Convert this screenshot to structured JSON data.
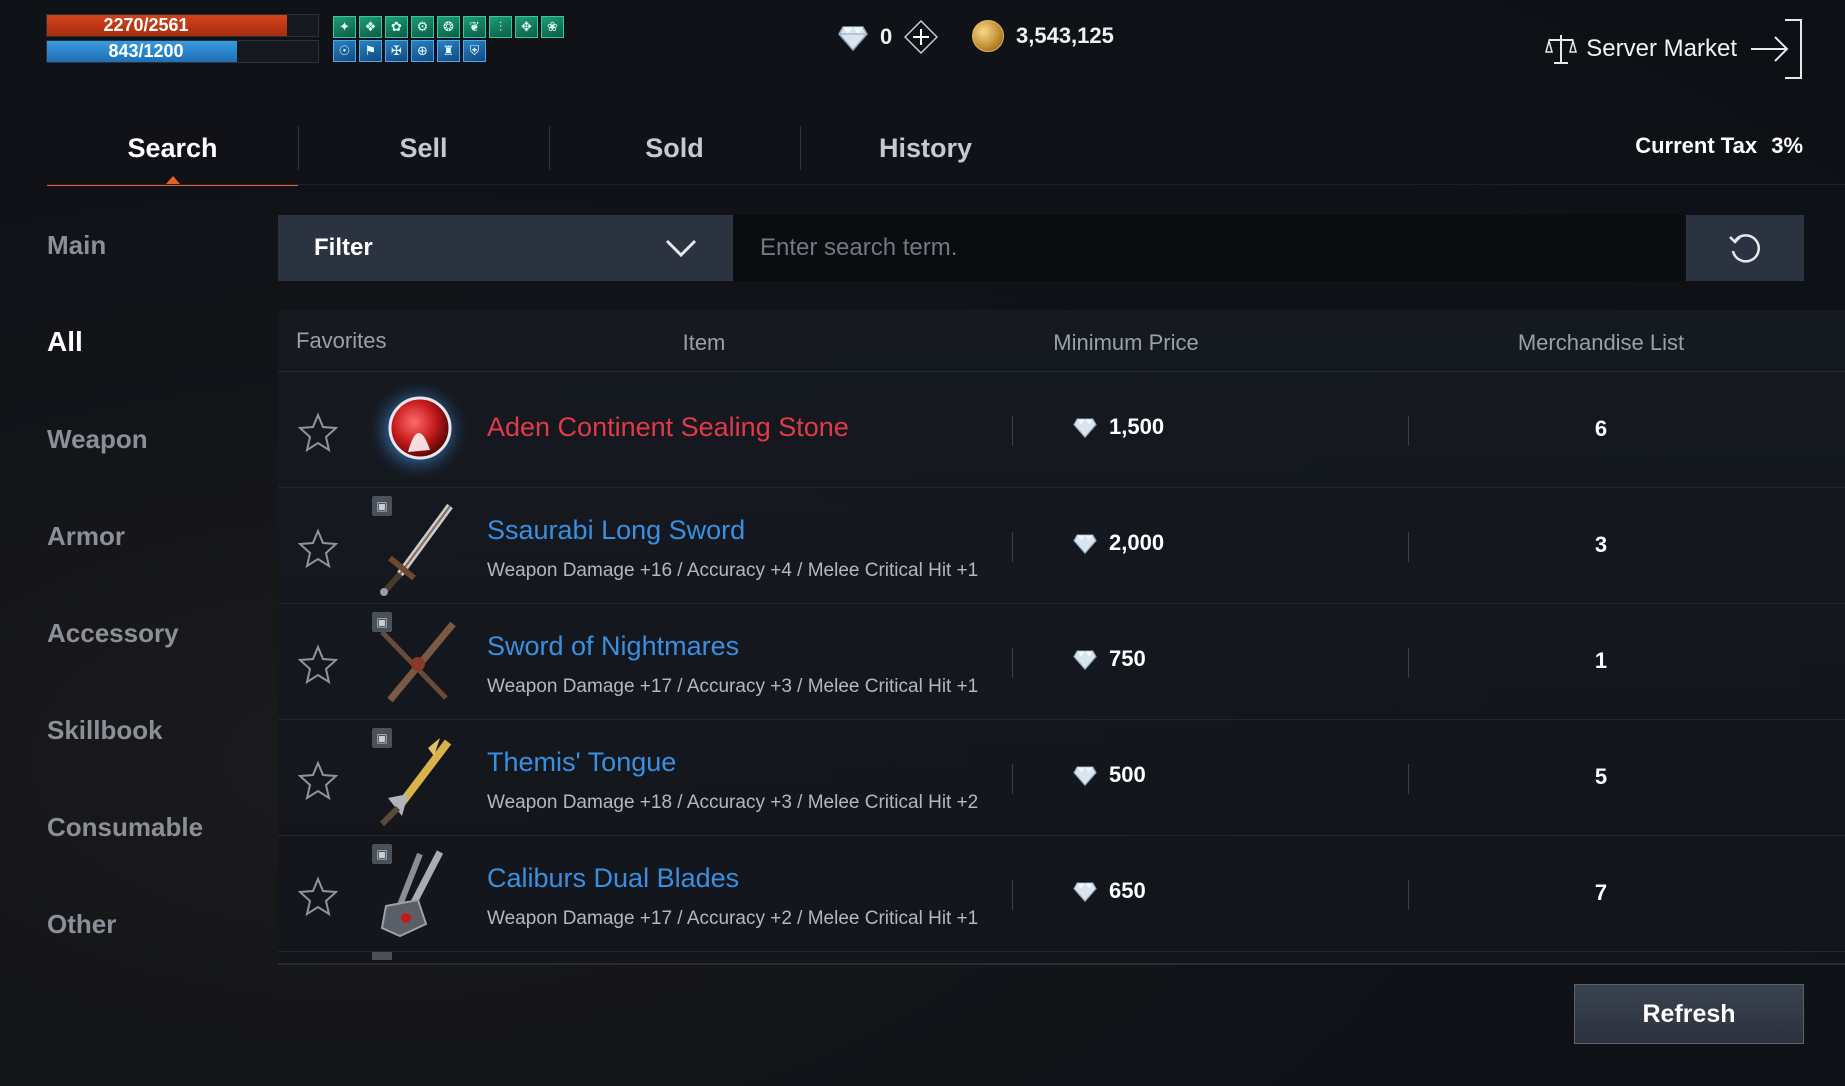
{
  "hud": {
    "hp_text": "2270/2561",
    "hp_ratio": 0.886,
    "mp_text": "843/1200",
    "mp_ratio": 0.7025,
    "buffs_row1": [
      "✦",
      "❖",
      "✿",
      "⚙",
      "❂",
      "❦",
      "⫶",
      "✥",
      "❀"
    ],
    "buffs_row2": [
      "☉",
      "⚑",
      "✠",
      "⊕",
      "♜",
      "⛨"
    ]
  },
  "currency": {
    "diamond": "0",
    "gold": "3,543,125"
  },
  "header": {
    "server_market": "Server Market",
    "current_tax_label": "Current Tax",
    "current_tax_value": "3%"
  },
  "tabs": [
    {
      "label": "Search",
      "active": true
    },
    {
      "label": "Sell",
      "active": false
    },
    {
      "label": "Sold",
      "active": false
    },
    {
      "label": "History",
      "active": false
    }
  ],
  "sidebar": {
    "items": [
      {
        "label": "Main"
      },
      {
        "label": "All"
      },
      {
        "label": "Weapon"
      },
      {
        "label": "Armor"
      },
      {
        "label": "Accessory"
      },
      {
        "label": "Skillbook"
      },
      {
        "label": "Consumable"
      },
      {
        "label": "Other"
      }
    ],
    "active_index": 1
  },
  "search": {
    "filter_label": "Filter",
    "placeholder": "Enter search term."
  },
  "table": {
    "headers": {
      "favorites": "Favorites",
      "item": "Item",
      "min_price": "Minimum Price",
      "merch_list": "Merchandise List"
    },
    "rows": [
      {
        "name": "Aden Continent Sealing Stone",
        "stats": "",
        "price": "1,500",
        "count": "6",
        "color": "#e03a4a",
        "icon": "sealing-stone-icon"
      },
      {
        "name": "Ssaurabi Long Sword",
        "stats": "Weapon Damage +16 / Accuracy +4 / Melee Critical Hit +1",
        "price": "2,000",
        "count": "3",
        "color": "#3a8fe0",
        "icon": "long-sword-icon"
      },
      {
        "name": "Sword of Nightmares",
        "stats": "Weapon Damage +17 / Accuracy +3 / Melee Critical Hit +1",
        "price": "750",
        "count": "1",
        "color": "#3a8fe0",
        "icon": "crossed-sword-icon"
      },
      {
        "name": "Themis' Tongue",
        "stats": "Weapon Damage +18 / Accuracy +3 / Melee Critical Hit +2",
        "price": "500",
        "count": "5",
        "color": "#3a8fe0",
        "icon": "golden-sword-icon"
      },
      {
        "name": "Caliburs Dual Blades",
        "stats": "Weapon Damage +17 / Accuracy +2 / Melee Critical Hit +1",
        "price": "650",
        "count": "7",
        "color": "#3a8fe0",
        "icon": "dual-blades-icon"
      }
    ]
  },
  "footer": {
    "refresh_label": "Refresh"
  }
}
